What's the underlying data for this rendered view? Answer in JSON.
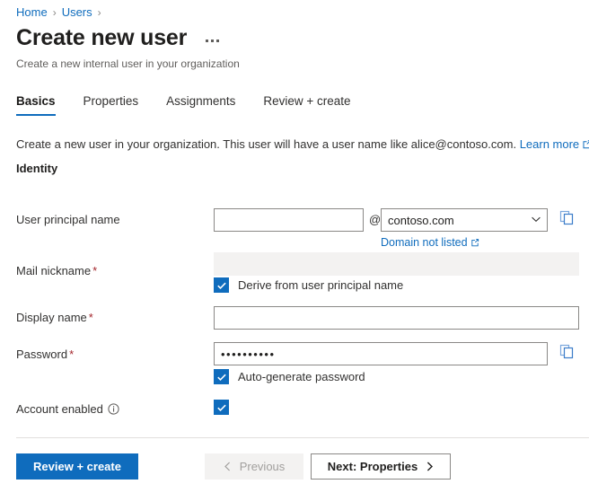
{
  "breadcrumb": {
    "items": [
      {
        "label": "Home"
      },
      {
        "label": "Users"
      }
    ],
    "separator": "›"
  },
  "header": {
    "title": "Create new user",
    "subtitle": "Create a new internal user in your organization",
    "more_menu": "more-commands"
  },
  "tabs": [
    {
      "label": "Basics",
      "active": true
    },
    {
      "label": "Properties",
      "active": false
    },
    {
      "label": "Assignments",
      "active": false
    },
    {
      "label": "Review + create",
      "active": false
    }
  ],
  "intro": {
    "text": "Create a new user in your organization. This user will have a user name like alice@contoso.com.",
    "link_label": "Learn more"
  },
  "section": {
    "title": "Identity"
  },
  "fields": {
    "user_principal_name": {
      "label": "User principal name",
      "required": false,
      "value": "",
      "placeholder": "",
      "at_symbol": "@",
      "domain_value": "contoso.com",
      "domain_link": "Domain not listed",
      "copy_icon": "copy-icon",
      "chevron_icon": "chevron-down-icon"
    },
    "mail_nickname": {
      "label": "Mail nickname",
      "required": true,
      "required_mark": "*",
      "value": "",
      "disabled": true,
      "derive_checkbox": {
        "label": "Derive from user principal name",
        "checked": true
      }
    },
    "display_name": {
      "label": "Display name",
      "required": true,
      "required_mark": "*",
      "value": "",
      "placeholder": ""
    },
    "password": {
      "label": "Password",
      "required": true,
      "required_mark": "*",
      "value": "••••••••••",
      "copy_icon": "copy-icon",
      "autogenerate_checkbox": {
        "label": "Auto-generate password",
        "checked": true
      }
    },
    "account_enabled": {
      "label": "Account enabled",
      "info_icon": "info-icon",
      "checked": true
    }
  },
  "footer": {
    "review_create_label": "Review + create",
    "previous_label": "Previous",
    "previous_disabled": true,
    "next_label": "Next: Properties"
  },
  "colors": {
    "accent": "#0f6cbd",
    "link": "#0f6cbd",
    "required": "#a4262c",
    "disabled_bg": "#f3f2f1",
    "border": "#8a8886",
    "text": "#323130"
  }
}
